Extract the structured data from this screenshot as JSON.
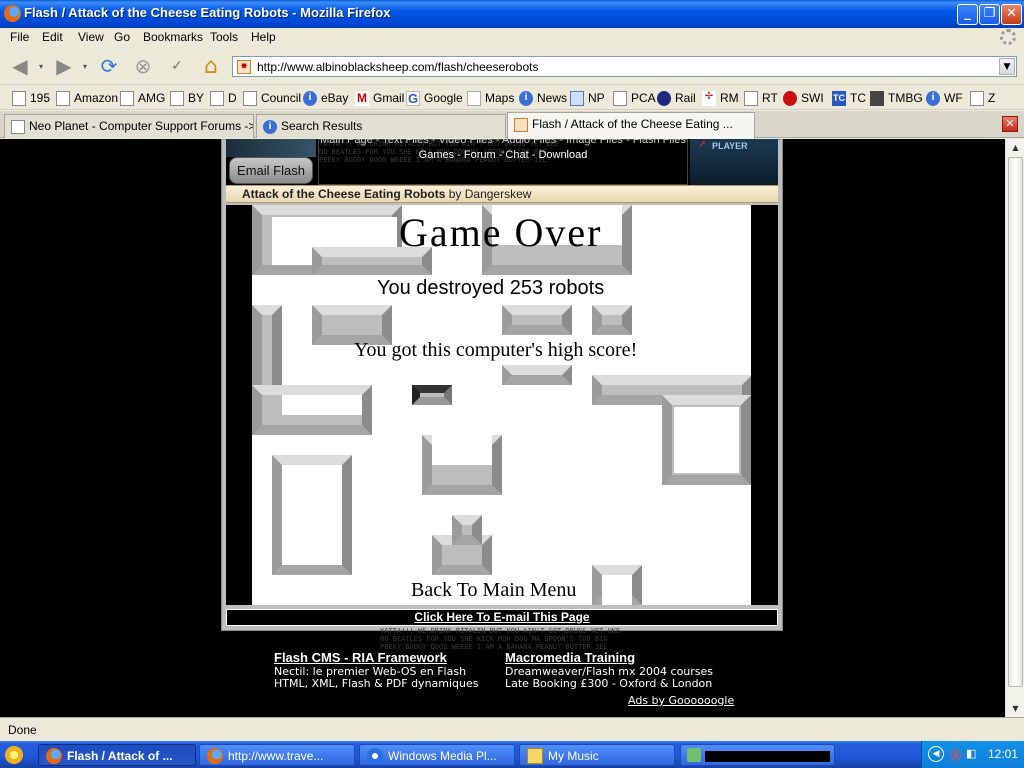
{
  "window": {
    "title": "Flash / Attack of the Cheese Eating Robots - Mozilla Firefox",
    "buttons": {
      "minimize": "_",
      "maximize": "❐",
      "close": "✕"
    }
  },
  "menu": [
    "File",
    "Edit",
    "View",
    "Go",
    "Bookmarks",
    "Tools",
    "Help"
  ],
  "nav": {
    "url": "http://www.albinoblacksheep.com/flash/cheeserobots",
    "icons": [
      "back-icon",
      "forward-icon",
      "reload-icon",
      "stop-icon",
      "spellcheck-icon",
      "home-icon"
    ]
  },
  "bookmarks": [
    {
      "label": "195",
      "icon": "page"
    },
    {
      "label": "Amazon",
      "icon": "page"
    },
    {
      "label": "AMG",
      "icon": "page"
    },
    {
      "label": "BY",
      "icon": "page"
    },
    {
      "label": "D",
      "icon": "page"
    },
    {
      "label": "Council",
      "icon": "page"
    },
    {
      "label": "eBay",
      "icon": "info"
    },
    {
      "label": "Gmail",
      "icon": "gmail"
    },
    {
      "label": "Google",
      "icon": "google"
    },
    {
      "label": "Maps",
      "icon": "maps"
    },
    {
      "label": "News",
      "icon": "info"
    },
    {
      "label": "NP",
      "icon": "np"
    },
    {
      "label": "PCA",
      "icon": "page"
    },
    {
      "label": "Rail",
      "icon": "rail"
    },
    {
      "label": "RM",
      "icon": "rm"
    },
    {
      "label": "RT",
      "icon": "page"
    },
    {
      "label": "SWI",
      "icon": "swi"
    },
    {
      "label": "TC",
      "icon": "tc"
    },
    {
      "label": "TMBG",
      "icon": "tmbg"
    },
    {
      "label": "WF",
      "icon": "info"
    },
    {
      "label": "Z",
      "icon": "page"
    }
  ],
  "tabs": [
    {
      "label": "Neo Planet - Computer Support Forums -> ..."
    },
    {
      "label": "Search Results"
    },
    {
      "label": "Flash / Attack of the Cheese Eating ..."
    }
  ],
  "site": {
    "email_flash": "Email Flash",
    "nav_line1": "Main Page - Text Files - Video Files - Audio Files - Image Files - Flash Files -",
    "nav_line2": "Games - Forum - Chat - Download",
    "player_label": "PLAYER",
    "game_title": "Attack of the Cheese Eating Robots",
    "game_by": "by Dangerskew",
    "email_page": "Click Here To E-mail This Page",
    "bg_lyrics": "YATTA!!! WE DRINK RITALIN BUT YOU AIN'T GOT DRUGS YET UKE\nNO BEATLES FOR YOU SHE KICK MUH DOG MA SPOON'S TOO BIG\nPEEKY BOOGY DOOG WEEEE I AM A BANANA PEANUT BUTTER JEL"
  },
  "game": {
    "heading": "Game Over",
    "score_line": "You destroyed 253 robots",
    "high_score": "You got this computer's high score!",
    "back_menu": "Back To Main Menu"
  },
  "ads": [
    {
      "title": "Flash CMS - RIA Framework",
      "line1": "Nectil: le premier Web-OS en Flash",
      "line2": "HTML, XML, Flash & PDF dynamiques"
    },
    {
      "title": "Macromedia Training",
      "line1": "Dreamweaver/Flash mx 2004 courses",
      "line2": "Late Booking £300 - Oxford & London"
    }
  ],
  "ads_by": "Ads by Goooooogle",
  "status": "Done",
  "taskbar": {
    "items": [
      {
        "label": "Flash / Attack of ...",
        "active": true
      },
      {
        "label": "http://www.trave...",
        "active": false
      },
      {
        "label": "Windows Media Pl...",
        "active": false
      },
      {
        "label": "My Music",
        "active": false
      }
    ],
    "clock": "12:01"
  }
}
